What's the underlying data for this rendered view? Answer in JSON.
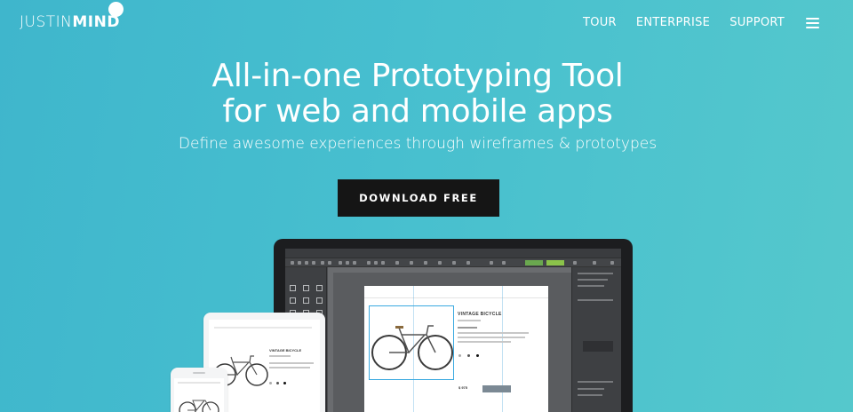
{
  "brand": {
    "name": "JUSTINMIND",
    "name_first": "JUSTIN",
    "name_second": "MIND"
  },
  "nav": {
    "items": [
      {
        "label": "TOUR"
      },
      {
        "label": "ENTERPRISE"
      },
      {
        "label": "SUPPORT"
      }
    ],
    "menu_icon": "hamburger-menu-icon"
  },
  "hero": {
    "headline_line1": "All-in-one Prototyping Tool",
    "headline_line2": "for web and mobile apps",
    "subheadline": "Define awesome experiences through wireframes & prototypes",
    "cta_label": "DOWNLOAD FREE"
  },
  "mockup": {
    "product_title": "VINTAGE BICYCLE",
    "product_title_tablet": "VINTAGE BICYCLE",
    "price": "$ 975",
    "add_to_cart": "ADD TO CART"
  },
  "colors": {
    "background_start": "#3fb6cc",
    "background_end": "#55c8cc",
    "cta_background": "#151515",
    "text": "#ffffff"
  }
}
